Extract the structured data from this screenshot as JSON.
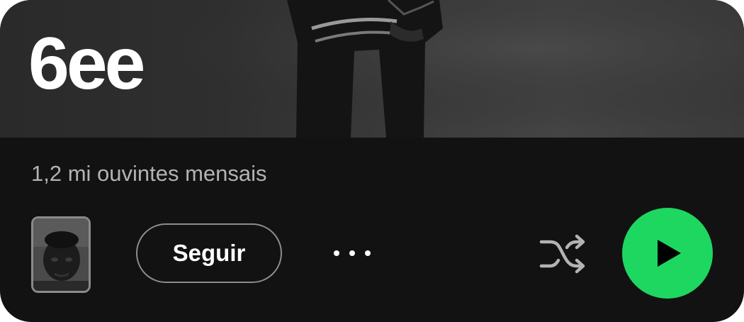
{
  "artist": {
    "name": "6ee",
    "monthly_listeners": "1,2 mi ouvintes mensais"
  },
  "actions": {
    "follow_label": "Seguir",
    "more_icon": "more-options-icon",
    "shuffle_icon": "shuffle-icon",
    "play_icon": "play-icon"
  },
  "colors": {
    "background": "#121212",
    "play_button": "#1ed760",
    "secondary_text": "#b3b3b3"
  }
}
